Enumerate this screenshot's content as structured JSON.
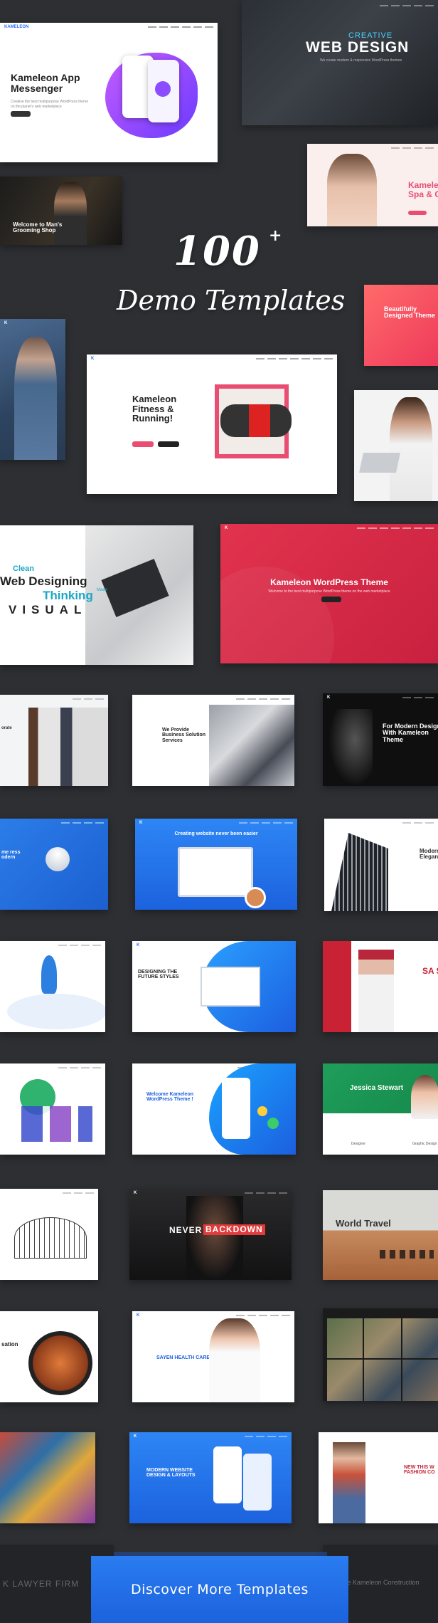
{
  "hero": {
    "count": "100",
    "plus": "+",
    "subtitle": "Demo Templates"
  },
  "demos": {
    "app": {
      "logo": "KAMELEON",
      "title": "Kameleon App Messenger",
      "desc": "Creative the best multipurpose WordPress theme on the planet’s web marketplace"
    },
    "webdesign": {
      "kicker": "CREATIVE",
      "title": "WEB DESIGN",
      "desc": "We create modern & responsive WordPress themes"
    },
    "spa": {
      "title": "Kameleon Spa & C"
    },
    "grooming": {
      "title": "Welcome to Man's Grooming Shop"
    },
    "beautiful": {
      "title": "Beautifully Designed Theme"
    },
    "fitness": {
      "title": "Kameleon Fitness & Running!"
    },
    "clean": {
      "l1": "Clean",
      "l2": "Web Designing",
      "l3": "Thinking",
      "l3b": "Made",
      "l4": "VISUAL"
    },
    "wptheme": {
      "title": "Kameleon WordPress Theme",
      "desc": "Welcome to the best multipurpose WordPress theme on the web marketplace"
    },
    "business": {
      "title": "We Provide Business Solution Services"
    },
    "corporate": {
      "title": "orate"
    },
    "moderndesign": {
      "title": "For Modern Design With Kameleon Theme"
    },
    "press": {
      "title": "me ress odern"
    },
    "creating": {
      "title": "Creating website never been easier"
    },
    "elegant": {
      "title": "Modern Elegan"
    },
    "future": {
      "title": "DESIGNING THE FUTURE STYLES"
    },
    "sale": {
      "title": "SA ST"
    },
    "welcomewp": {
      "title": "Welcome Kameleon WordPress Theme !"
    },
    "jessica": {
      "title": "Jessica Stewart",
      "left": "Designer",
      "right": "Graphic Design"
    },
    "never": {
      "title": "NEVER",
      "highlight": "BACKDOWN"
    },
    "travel": {
      "title": "World Travel"
    },
    "health": {
      "title": "SAYEN HEALTH CARE"
    },
    "sation": {
      "title": "sation"
    },
    "modern": {
      "title": "MODERN WEBSITE DESIGN & LAYOUTS"
    },
    "newthis": {
      "title": "NEW THIS W FASHION CO"
    },
    "lawyer": {
      "title": "K LAWYER FIRM"
    },
    "construction": {
      "title": "The Kameleon Construction"
    }
  },
  "cta": {
    "label": "Discover More Templates"
  }
}
